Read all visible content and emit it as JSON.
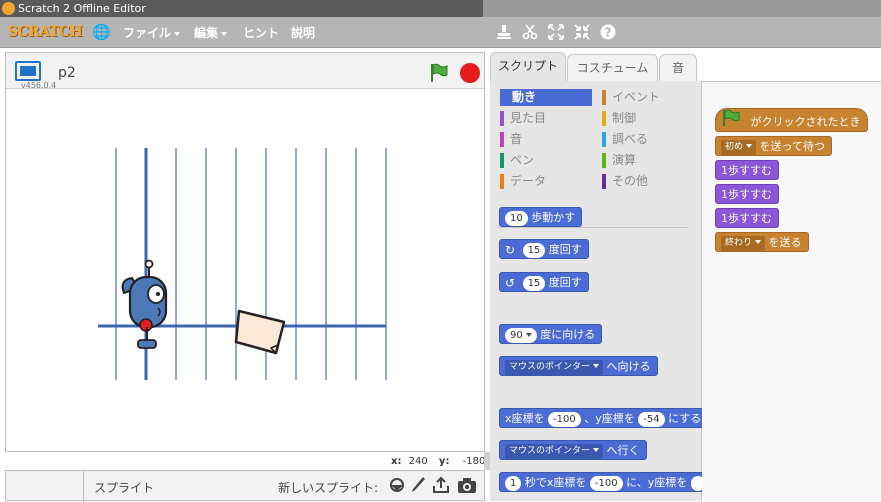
{
  "window": {
    "title": "Scratch 2 Offline Editor"
  },
  "menu": {
    "logo": "SCRATCH",
    "file": "ファイル",
    "edit": "編集",
    "hints": "ヒント",
    "about": "説明"
  },
  "stage": {
    "project_name": "p2",
    "version": "v456.0.4",
    "coord_x_label": "x:",
    "coord_x": "240",
    "coord_y_label": "y:",
    "coord_y": "-180"
  },
  "sprites": {
    "title": "スプライト",
    "new_sprite_label": "新しいスプライト:"
  },
  "tabs": {
    "scripts": "スクリプト",
    "costumes": "コスチューム",
    "sounds": "音"
  },
  "categories": [
    {
      "label": "動き",
      "color": "#4a6cd4",
      "active": true
    },
    {
      "label": "見た目",
      "color": "#8a55d7"
    },
    {
      "label": "音",
      "color": "#bb42c3"
    },
    {
      "label": "ペン",
      "color": "#0e9a6c"
    },
    {
      "label": "データ",
      "color": "#ee7d16"
    },
    {
      "label": "イベント",
      "color": "#c88330"
    },
    {
      "label": "制御",
      "color": "#e1a91a"
    },
    {
      "label": "調べる",
      "color": "#2ca5e2"
    },
    {
      "label": "演算",
      "color": "#5cb712"
    },
    {
      "label": "その他",
      "color": "#632d99"
    }
  ],
  "palette_blocks": {
    "move": {
      "value": "10",
      "text": "歩動かす"
    },
    "turn_right": {
      "value": "15",
      "text": "度回す"
    },
    "turn_left": {
      "value": "15",
      "text": "度回す"
    },
    "point_dir": {
      "value": "90",
      "text": "度に向ける"
    },
    "point_towards": {
      "option": "マウスのポインター",
      "text": "へ向ける"
    },
    "goto_xy": {
      "pre": "x座標を",
      "x": "-100",
      "mid": "、y座標を",
      "y": "-54",
      "post": "にする"
    },
    "goto": {
      "option": "マウスのポインター",
      "text": "へ行く"
    },
    "glide": {
      "secs": "1",
      "pre": "秒でx座標を",
      "x": "-100",
      "post": "に、y座標を"
    }
  },
  "script": {
    "hat": "がクリックされたとき",
    "broadcast_wait": {
      "option": "初め",
      "text": "を送って待つ"
    },
    "say1": "1歩すすむ",
    "say2": "1歩すすむ",
    "say3": "1歩すすむ",
    "broadcast": {
      "option": "終わり",
      "text": "を送る"
    }
  }
}
